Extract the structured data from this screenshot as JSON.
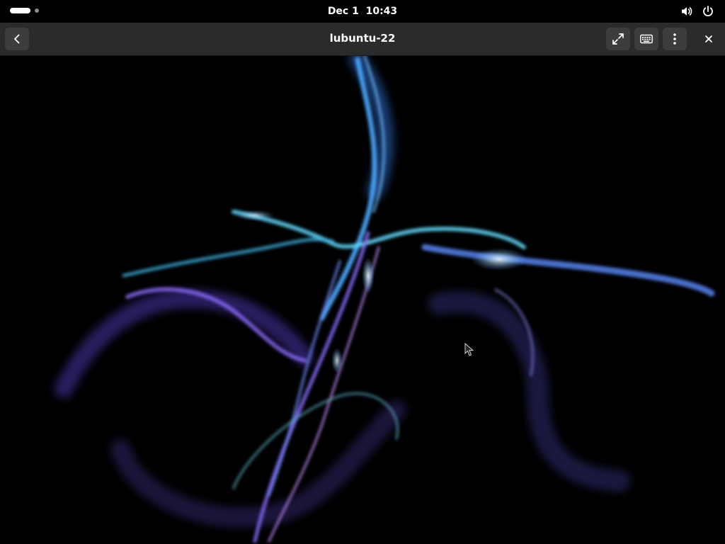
{
  "topbar": {
    "date": "Dec 1",
    "time": "10:43",
    "icons": [
      "workspace-indicator",
      "volume-icon",
      "power-icon"
    ]
  },
  "headerbar": {
    "title": "lubuntu-22",
    "icons": [
      "back-arrow-icon",
      "fullscreen-icon",
      "keyboard-icon",
      "more-options-icon",
      "close-icon"
    ]
  },
  "remote_view": {
    "content": "screensaver-light-ribbons",
    "accent_colors": [
      "#4fa8ff",
      "#7a5cff",
      "#6fe0ff",
      "#b070ff"
    ]
  }
}
